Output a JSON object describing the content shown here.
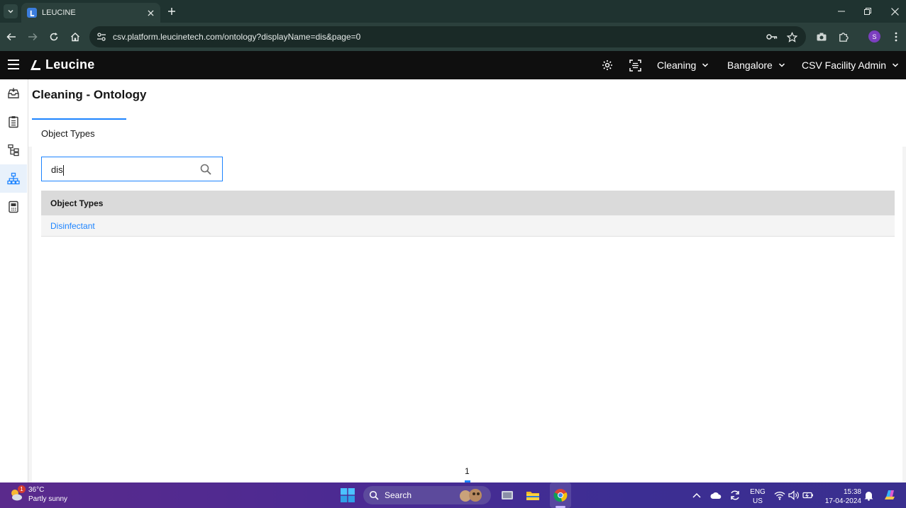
{
  "browser": {
    "tab_title": "LEUCINE",
    "url": "csv.platform.leucinetech.com/ontology?displayName=dis&page=0",
    "profile_initial": "S"
  },
  "app": {
    "brand": "Leucine",
    "use_case": "Cleaning",
    "facility": "Bangalore",
    "role": "CSV Facility Admin"
  },
  "page": {
    "title": "Cleaning - Ontology",
    "tabs": [
      {
        "label": "Object Types",
        "active": true
      }
    ],
    "search": {
      "value": "dis"
    },
    "table": {
      "header": "Object Types",
      "rows": [
        "Disinfectant"
      ]
    },
    "pagination": {
      "current": "1"
    }
  },
  "taskbar": {
    "weather_temp": "36°C",
    "weather_desc": "Partly sunny",
    "weather_badge": "1",
    "search_label": "Search",
    "lang_top": "ENG",
    "lang_bottom": "US",
    "time": "15:38",
    "date": "17-04-2024"
  },
  "colors": {
    "accent": "#1d84ff",
    "header_bg": "#0f0f0f",
    "browser_chrome": "#2b403c"
  }
}
